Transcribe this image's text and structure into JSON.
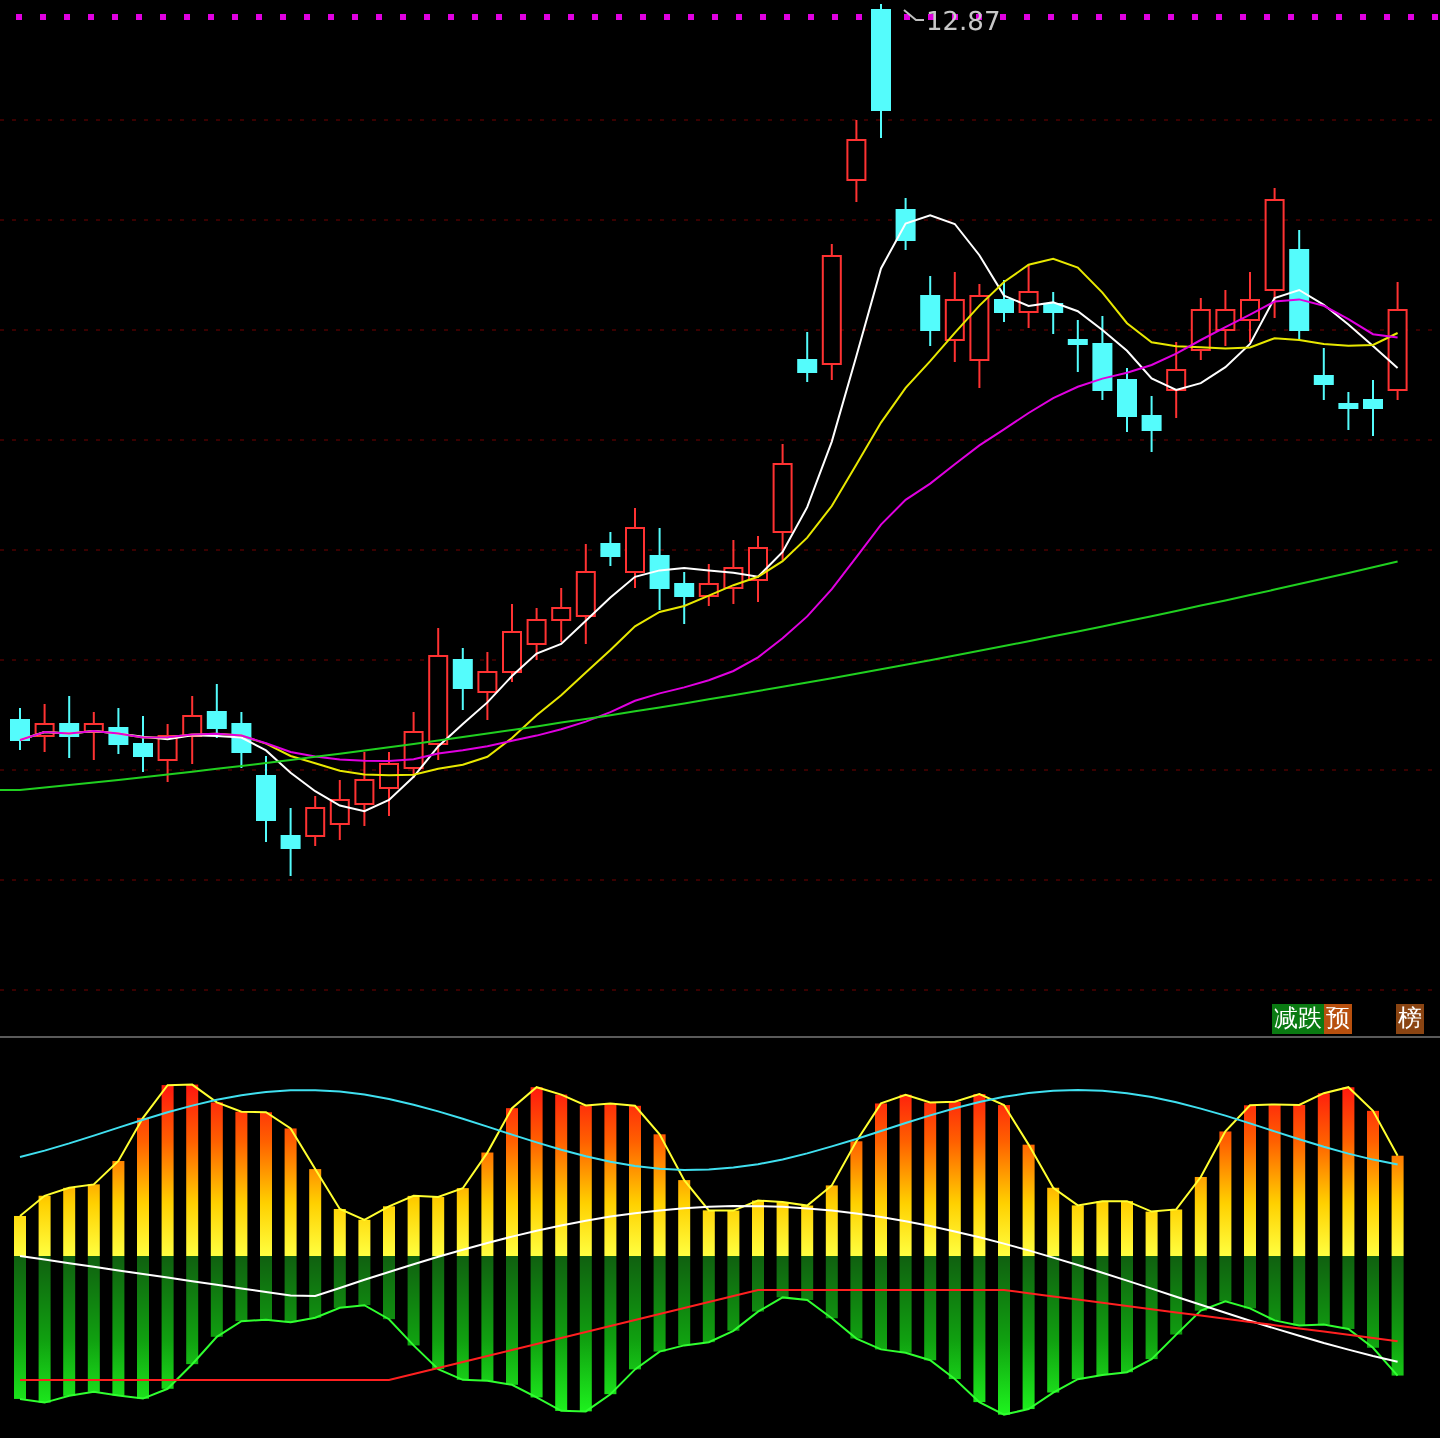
{
  "price_chart": {
    "high_label": "12.87"
  },
  "indicator_panel": {
    "tags": [
      {
        "text": "减跌",
        "color": "#0a7a12"
      },
      {
        "text": "预",
        "color": "#b8500e"
      },
      {
        "text": "榜",
        "color": "#8a4412"
      }
    ]
  }
}
